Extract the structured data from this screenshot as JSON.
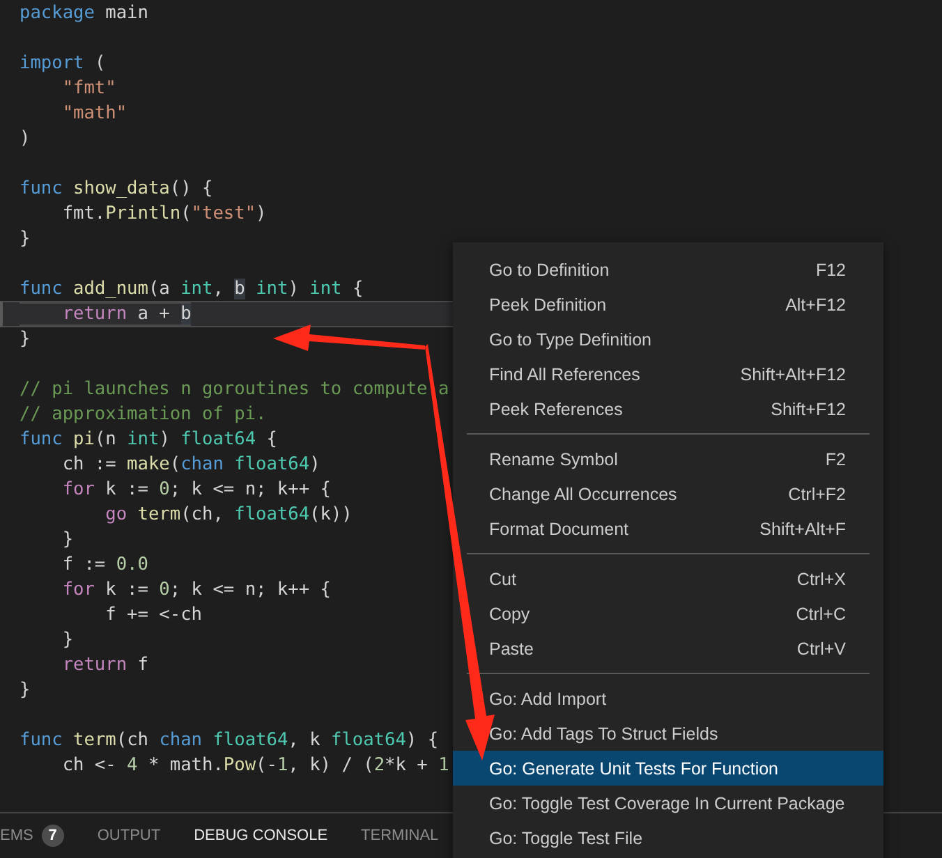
{
  "editor": {
    "lines": [
      {
        "kind": "code",
        "current": false,
        "tokens": [
          {
            "kind": "kw",
            "text": "package"
          },
          {
            "kind": "plain",
            "text": " main"
          }
        ]
      },
      {
        "kind": "blank"
      },
      {
        "kind": "code",
        "current": false,
        "tokens": [
          {
            "kind": "kw",
            "text": "import"
          },
          {
            "kind": "plain",
            "text": " ("
          }
        ]
      },
      {
        "kind": "code",
        "current": false,
        "tokens": [
          {
            "kind": "str",
            "text": "    \"fmt\""
          }
        ]
      },
      {
        "kind": "code",
        "current": false,
        "tokens": [
          {
            "kind": "str",
            "text": "    \"math\""
          }
        ]
      },
      {
        "kind": "code",
        "current": false,
        "tokens": [
          {
            "kind": "plain",
            "text": ")"
          }
        ]
      },
      {
        "kind": "blank"
      },
      {
        "kind": "code",
        "current": false,
        "tokens": [
          {
            "kind": "kw",
            "text": "func"
          },
          {
            "kind": "fn",
            "text": " show_data"
          },
          {
            "kind": "plain",
            "text": "() {"
          }
        ]
      },
      {
        "kind": "code",
        "current": false,
        "tokens": [
          {
            "kind": "plain",
            "text": "    fmt."
          },
          {
            "kind": "fn",
            "text": "Println"
          },
          {
            "kind": "plain",
            "text": "("
          },
          {
            "kind": "str",
            "text": "\"test\""
          },
          {
            "kind": "plain",
            "text": ")"
          }
        ]
      },
      {
        "kind": "code",
        "current": false,
        "tokens": [
          {
            "kind": "plain",
            "text": "}"
          }
        ]
      },
      {
        "kind": "blank"
      },
      {
        "kind": "code",
        "current": false,
        "tokens": [
          {
            "kind": "kw",
            "text": "func"
          },
          {
            "kind": "fn",
            "text": " add_num"
          },
          {
            "kind": "plain",
            "text": "(a"
          },
          {
            "kind": "type",
            "text": " int"
          },
          {
            "kind": "plain",
            "text": ", "
          },
          {
            "kind": "hl",
            "text": "b"
          },
          {
            "kind": "type",
            "text": " int"
          },
          {
            "kind": "plain",
            "text": ")"
          },
          {
            "kind": "type",
            "text": " int"
          },
          {
            "kind": "plain",
            "text": " {"
          }
        ]
      },
      {
        "kind": "code",
        "current": true,
        "tokens": [
          {
            "kind": "ctl",
            "text": "    return"
          },
          {
            "kind": "plain",
            "text": " a + "
          },
          {
            "kind": "hl",
            "text": "b"
          }
        ]
      },
      {
        "kind": "code",
        "current": false,
        "tokens": [
          {
            "kind": "plain",
            "text": "}"
          }
        ]
      },
      {
        "kind": "blank"
      },
      {
        "kind": "code",
        "current": false,
        "tokens": [
          {
            "kind": "cmt",
            "text": "// pi launches n goroutines to compute a"
          }
        ]
      },
      {
        "kind": "code",
        "current": false,
        "tokens": [
          {
            "kind": "cmt",
            "text": "// approximation of pi."
          }
        ]
      },
      {
        "kind": "code",
        "current": false,
        "tokens": [
          {
            "kind": "kw",
            "text": "func"
          },
          {
            "kind": "fn",
            "text": " pi"
          },
          {
            "kind": "plain",
            "text": "(n"
          },
          {
            "kind": "type",
            "text": " int"
          },
          {
            "kind": "plain",
            "text": ")"
          },
          {
            "kind": "type",
            "text": " float64"
          },
          {
            "kind": "plain",
            "text": " {"
          }
        ]
      },
      {
        "kind": "code",
        "current": false,
        "tokens": [
          {
            "kind": "plain",
            "text": "    ch := "
          },
          {
            "kind": "fn",
            "text": "make"
          },
          {
            "kind": "plain",
            "text": "("
          },
          {
            "kind": "kw",
            "text": "chan"
          },
          {
            "kind": "type",
            "text": " float64"
          },
          {
            "kind": "plain",
            "text": ")"
          }
        ]
      },
      {
        "kind": "code",
        "current": false,
        "tokens": [
          {
            "kind": "ctl",
            "text": "    for"
          },
          {
            "kind": "plain",
            "text": " k := "
          },
          {
            "kind": "num",
            "text": "0"
          },
          {
            "kind": "plain",
            "text": "; k <= n; k++ {"
          }
        ]
      },
      {
        "kind": "code",
        "current": false,
        "tokens": [
          {
            "kind": "ctl",
            "text": "        go"
          },
          {
            "kind": "fn",
            "text": " term"
          },
          {
            "kind": "plain",
            "text": "(ch, "
          },
          {
            "kind": "type",
            "text": "float64"
          },
          {
            "kind": "plain",
            "text": "(k))"
          }
        ]
      },
      {
        "kind": "code",
        "current": false,
        "tokens": [
          {
            "kind": "plain",
            "text": "    }"
          }
        ]
      },
      {
        "kind": "code",
        "current": false,
        "tokens": [
          {
            "kind": "plain",
            "text": "    f := "
          },
          {
            "kind": "num",
            "text": "0.0"
          }
        ]
      },
      {
        "kind": "code",
        "current": false,
        "tokens": [
          {
            "kind": "ctl",
            "text": "    for"
          },
          {
            "kind": "plain",
            "text": " k := "
          },
          {
            "kind": "num",
            "text": "0"
          },
          {
            "kind": "plain",
            "text": "; k <= n; k++ {"
          }
        ]
      },
      {
        "kind": "code",
        "current": false,
        "tokens": [
          {
            "kind": "plain",
            "text": "        f += <-ch"
          }
        ]
      },
      {
        "kind": "code",
        "current": false,
        "tokens": [
          {
            "kind": "plain",
            "text": "    }"
          }
        ]
      },
      {
        "kind": "code",
        "current": false,
        "tokens": [
          {
            "kind": "ctl",
            "text": "    return"
          },
          {
            "kind": "plain",
            "text": " f"
          }
        ]
      },
      {
        "kind": "code",
        "current": false,
        "tokens": [
          {
            "kind": "plain",
            "text": "}"
          }
        ]
      },
      {
        "kind": "blank"
      },
      {
        "kind": "code",
        "current": false,
        "tokens": [
          {
            "kind": "kw",
            "text": "func"
          },
          {
            "kind": "fn",
            "text": " term"
          },
          {
            "kind": "plain",
            "text": "(ch"
          },
          {
            "kind": "kw",
            "text": " chan"
          },
          {
            "kind": "type",
            "text": " float64"
          },
          {
            "kind": "plain",
            "text": ", k"
          },
          {
            "kind": "type",
            "text": " float64"
          },
          {
            "kind": "plain",
            "text": ") {"
          }
        ]
      },
      {
        "kind": "code",
        "current": false,
        "tokens": [
          {
            "kind": "plain",
            "text": "    ch <- "
          },
          {
            "kind": "num",
            "text": "4"
          },
          {
            "kind": "plain",
            "text": " * math."
          },
          {
            "kind": "fn",
            "text": "Pow"
          },
          {
            "kind": "plain",
            "text": "(-"
          },
          {
            "kind": "num",
            "text": "1"
          },
          {
            "kind": "plain",
            "text": ", k) / ("
          },
          {
            "kind": "num",
            "text": "2"
          },
          {
            "kind": "plain",
            "text": "*k + "
          },
          {
            "kind": "num",
            "text": "1"
          }
        ]
      }
    ]
  },
  "context_menu": {
    "groups": [
      [
        {
          "label": "Go to Definition",
          "shortcut": "F12",
          "selected": false
        },
        {
          "label": "Peek Definition",
          "shortcut": "Alt+F12",
          "selected": false
        },
        {
          "label": "Go to Type Definition",
          "selected": false
        },
        {
          "label": "Find All References",
          "shortcut": "Shift+Alt+F12",
          "selected": false
        },
        {
          "label": "Peek References",
          "shortcut": "Shift+F12",
          "selected": false
        }
      ],
      [
        {
          "label": "Rename Symbol",
          "shortcut": "F2",
          "selected": false
        },
        {
          "label": "Change All Occurrences",
          "shortcut": "Ctrl+F2",
          "selected": false
        },
        {
          "label": "Format Document",
          "shortcut": "Shift+Alt+F",
          "selected": false
        }
      ],
      [
        {
          "label": "Cut",
          "shortcut": "Ctrl+X",
          "selected": false
        },
        {
          "label": "Copy",
          "shortcut": "Ctrl+C",
          "selected": false
        },
        {
          "label": "Paste",
          "shortcut": "Ctrl+V",
          "selected": false
        }
      ],
      [
        {
          "label": "Go: Add Import",
          "selected": false
        },
        {
          "label": "Go: Add Tags To Struct Fields",
          "selected": false
        },
        {
          "label": "Go: Generate Unit Tests For Function",
          "selected": true
        },
        {
          "label": "Go: Toggle Test Coverage In Current Package",
          "selected": false
        },
        {
          "label": "Go: Toggle Test File",
          "selected": false
        }
      ]
    ]
  },
  "panel": {
    "tabs": [
      {
        "label": "EMS",
        "badge": "7",
        "selected": false
      },
      {
        "label": "OUTPUT",
        "selected": false
      },
      {
        "label": "DEBUG CONSOLE",
        "selected": true
      },
      {
        "label": "TERMINAL",
        "selected": false
      }
    ]
  }
}
